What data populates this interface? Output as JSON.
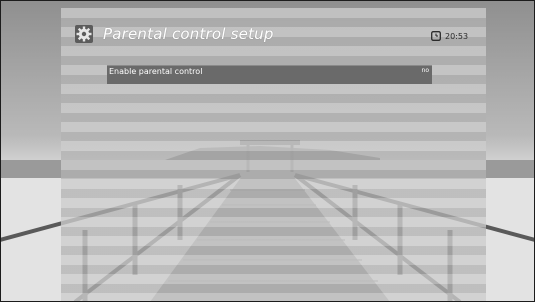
{
  "screen": {
    "title": "Parental control setup",
    "title_icon": "gear-icon",
    "clock_icon": "clock-icon",
    "time": "20:53"
  },
  "menu": {
    "items": [
      {
        "label": "Enable parental control",
        "value": "no",
        "selected": true
      }
    ]
  },
  "colors": {
    "selected_row": "#6a6a6a",
    "title_text": "#ffffff",
    "panel_stripe_light": "#cdcdcd",
    "panel_stripe_dark": "#b2b2b2"
  }
}
